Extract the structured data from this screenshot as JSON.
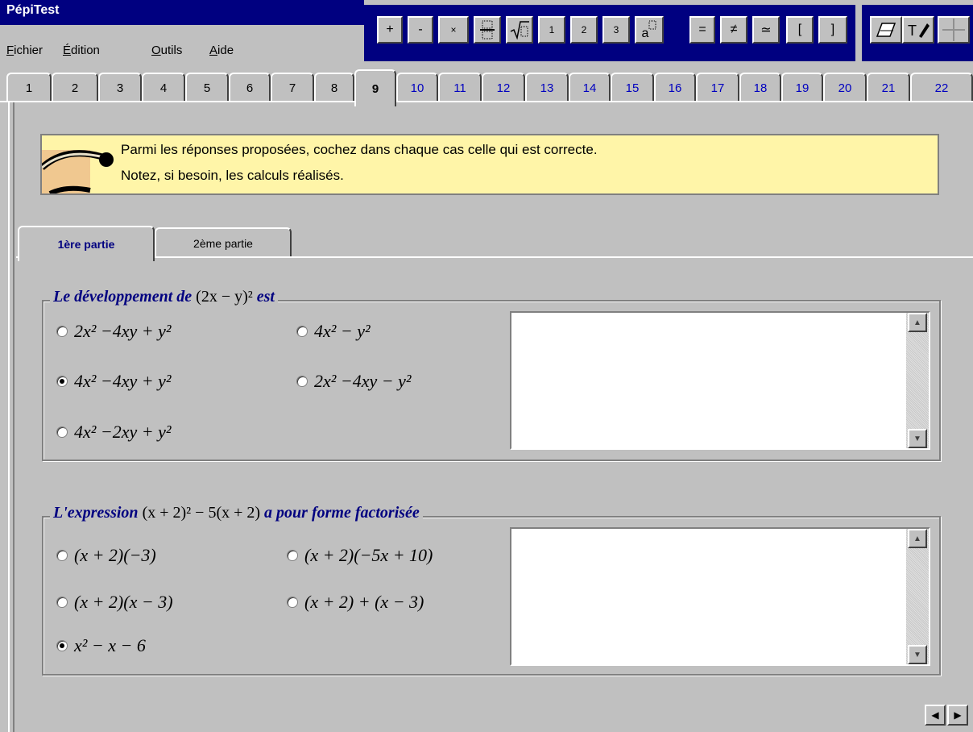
{
  "app": {
    "title": "PépiTest"
  },
  "menu": {
    "items": [
      "Fichier",
      "Édition",
      "Outils",
      "Aide"
    ]
  },
  "toolbar": {
    "math_buttons": [
      "+",
      "-",
      "×",
      "fraction",
      "√",
      "1",
      "2",
      "3",
      "a",
      "=",
      "≠",
      "≃",
      "[",
      "]"
    ],
    "tools": [
      "eraser-icon",
      "text-pen-icon",
      "crosshair-icon"
    ]
  },
  "page_tabs": {
    "items": [
      "1",
      "2",
      "3",
      "4",
      "5",
      "6",
      "7",
      "8",
      "9",
      "10",
      "11",
      "12",
      "13",
      "14",
      "15",
      "16",
      "17",
      "18",
      "19",
      "20",
      "21",
      "22"
    ],
    "active": "9"
  },
  "instruction": {
    "line1": "Parmi les réponses proposées, cochez dans chaque cas celle qui est correcte.",
    "line2": "Notez, si besoin, les calculs réalisés."
  },
  "sub_tabs": {
    "items": [
      "1ère partie",
      "2ème partie"
    ],
    "active": "1ère partie"
  },
  "question1": {
    "legend_prefix": "Le développement de",
    "legend_expr": "(2x − y)²",
    "legend_suffix": "est",
    "options": [
      {
        "label": "2x² −4xy + y²",
        "selected": false
      },
      {
        "label": "4x² − y²",
        "selected": false
      },
      {
        "label": "4x² −4xy + y²",
        "selected": true
      },
      {
        "label": "2x² −4xy − y²",
        "selected": false
      },
      {
        "label": "4x² −2xy + y²",
        "selected": false
      }
    ]
  },
  "question2": {
    "legend_prefix": "L'expression",
    "legend_expr": "(x + 2)² − 5(x + 2)",
    "legend_suffix": "a pour forme factorisée",
    "options": [
      {
        "label": "(x + 2)(−3)",
        "selected": false
      },
      {
        "label": "(x + 2)(−5x + 10)",
        "selected": false
      },
      {
        "label": "(x + 2)(x − 3)",
        "selected": false
      },
      {
        "label": "(x + 2) + (x − 3)",
        "selected": false
      },
      {
        "label": "x² − x − 6",
        "selected": true
      }
    ]
  },
  "nav": {
    "prev": "◀",
    "next": "▶"
  }
}
